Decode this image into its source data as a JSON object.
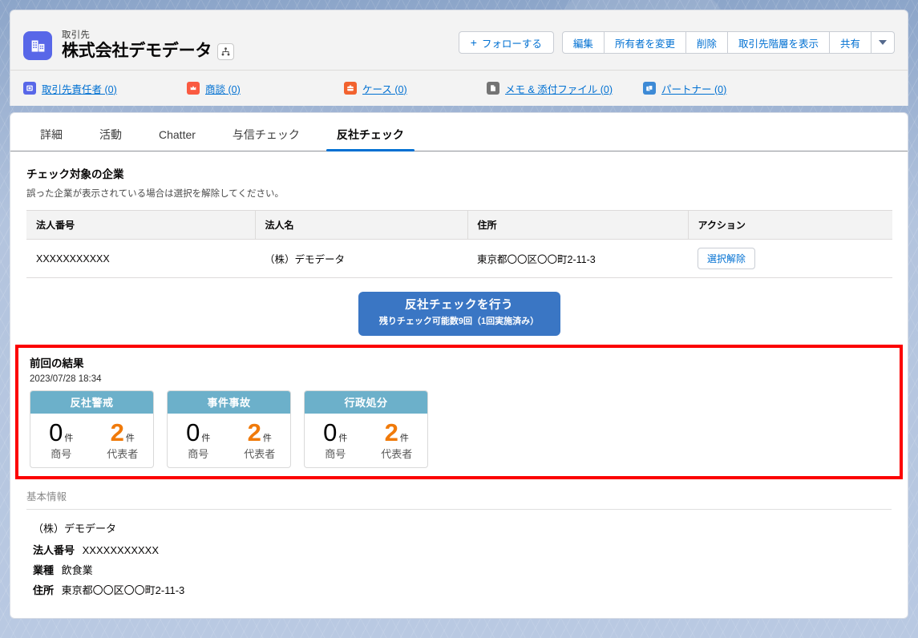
{
  "header": {
    "object_label": "取引先",
    "record_name": "株式会社デモデータ",
    "logo_icon": "building-icon",
    "hierarchy_icon": "org-hierarchy-icon",
    "actions": {
      "follow": "フォローする",
      "follow_icon": "plus-icon",
      "edit": "編集",
      "change_owner": "所有者を変更",
      "delete": "削除",
      "view_hierarchy": "取引先階層を表示",
      "share": "共有",
      "more_icon": "chevron-down-icon"
    },
    "related": [
      {
        "label": "取引先責任者 (0)",
        "icon": "contact-icon",
        "color": "#5867e8"
      },
      {
        "label": "商談 (0)",
        "icon": "opportunity-icon",
        "color": "#fa5a41"
      },
      {
        "label": "ケース (0)",
        "icon": "case-icon",
        "color": "#f2622e"
      },
      {
        "label": "メモ & 添付ファイル (0)",
        "icon": "note-attachment-icon",
        "color": "#747474"
      },
      {
        "label": "パートナー (0)",
        "icon": "partner-icon",
        "color": "#3d8ad6"
      }
    ]
  },
  "tabs": [
    {
      "label": "詳細",
      "active": false
    },
    {
      "label": "活動",
      "active": false
    },
    {
      "label": "Chatter",
      "active": false
    },
    {
      "label": "与信チェック",
      "active": false
    },
    {
      "label": "反社チェック",
      "active": true
    }
  ],
  "check_section": {
    "title": "チェック対象の企業",
    "subtitle": "誤った企業が表示されている場合は選択を解除してください。",
    "columns": [
      "法人番号",
      "法人名",
      "住所",
      "アクション"
    ],
    "rows": [
      {
        "corporate_number": "XXXXXXXXXXX",
        "corporate_name": "（株）デモデータ",
        "address": "東京都〇〇区〇〇町2-11-3",
        "action_label": "選択解除"
      }
    ],
    "primary_button": {
      "main": "反社チェックを行う",
      "sub": "残りチェック可能数9回（1回実施済み）",
      "color": "#3a76c4"
    }
  },
  "last_result": {
    "title": "前回の結果",
    "timestamp": "2023/07/28 18:34",
    "highlight_color": "#fc0000",
    "card_header_color": "#6cb0ca",
    "warn_color": "#f07a0a",
    "unit": "件",
    "cards": [
      {
        "title": "反社警戒",
        "metrics": [
          {
            "value": "0",
            "label": "商号",
            "warn": false
          },
          {
            "value": "2",
            "label": "代表者",
            "warn": true
          }
        ]
      },
      {
        "title": "事件事故",
        "metrics": [
          {
            "value": "0",
            "label": "商号",
            "warn": false
          },
          {
            "value": "2",
            "label": "代表者",
            "warn": true
          }
        ]
      },
      {
        "title": "行政処分",
        "metrics": [
          {
            "value": "0",
            "label": "商号",
            "warn": false
          },
          {
            "value": "2",
            "label": "代表者",
            "warn": true
          }
        ]
      }
    ]
  },
  "basic_info": {
    "section_label": "基本情報",
    "company_name": "（株）デモデータ",
    "fields": [
      {
        "key": "法人番号",
        "value": "XXXXXXXXXXX"
      },
      {
        "key": "業種",
        "value": "飲食業"
      },
      {
        "key": "住所",
        "value": "東京都〇〇区〇〇町2-11-3"
      }
    ]
  }
}
